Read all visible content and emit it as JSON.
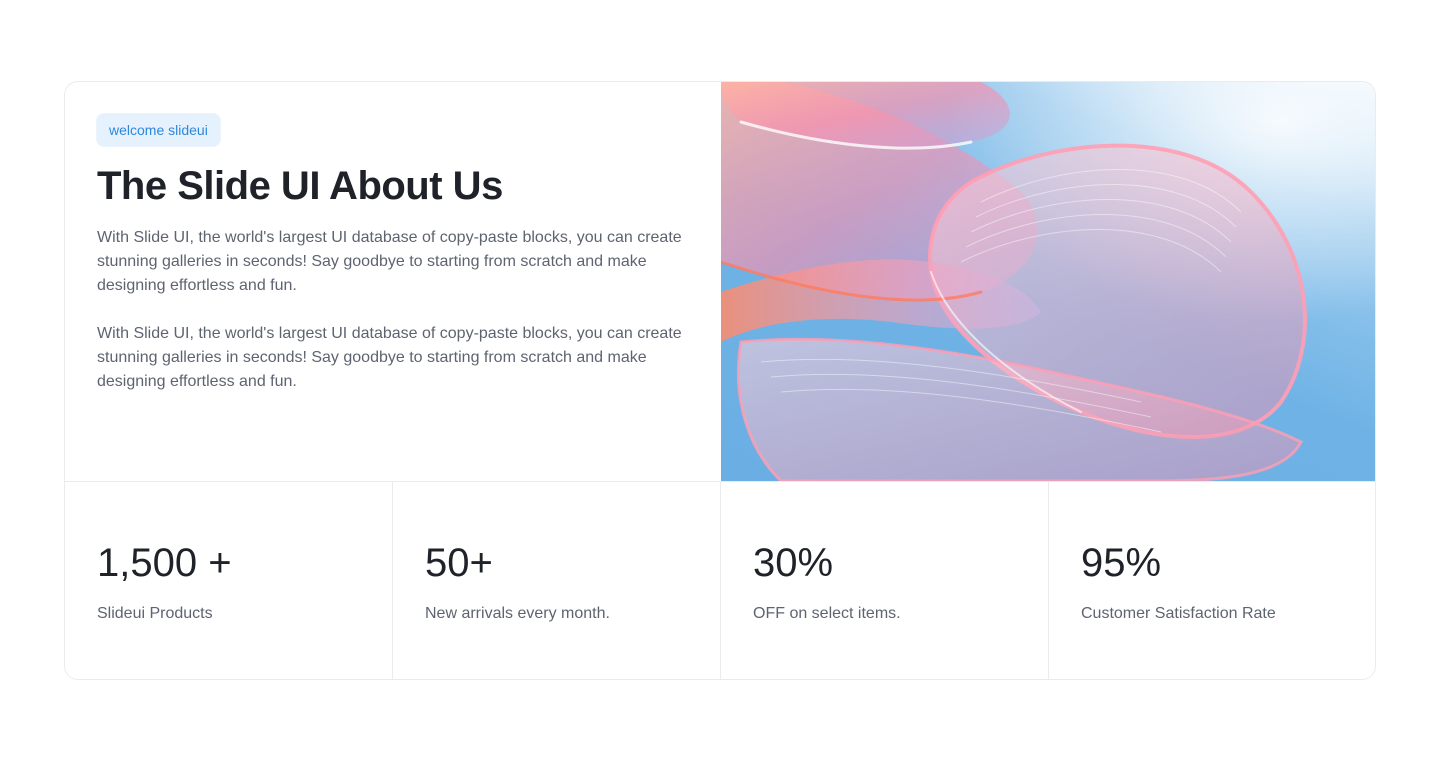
{
  "about": {
    "badge": "welcome slideui",
    "title": "The Slide UI About Us",
    "paragraphs": [
      "With Slide UI, the world's largest UI database of copy-paste blocks, you can create stunning galleries in seconds! Say goodbye to starting from scratch and make designing effortless and fun.",
      "With Slide UI, the world's largest UI database of copy-paste blocks, you can create stunning galleries in seconds! Say goodbye to starting from scratch and make designing effortless and fun."
    ]
  },
  "hero_image": {
    "colors": {
      "sky_light": "#e9f4fc",
      "sky": "#6fb3e6",
      "pink": "#f58fa6",
      "coral": "#ff8a6b",
      "rim": "#ff9fb4"
    }
  },
  "stats": [
    {
      "value": "1,500 +",
      "label": "Slideui Products"
    },
    {
      "value": "50+",
      "label": "New arrivals every month."
    },
    {
      "value": "30%",
      "label": "OFF on select items."
    },
    {
      "value": "95%",
      "label": "Customer Satisfaction Rate"
    }
  ]
}
